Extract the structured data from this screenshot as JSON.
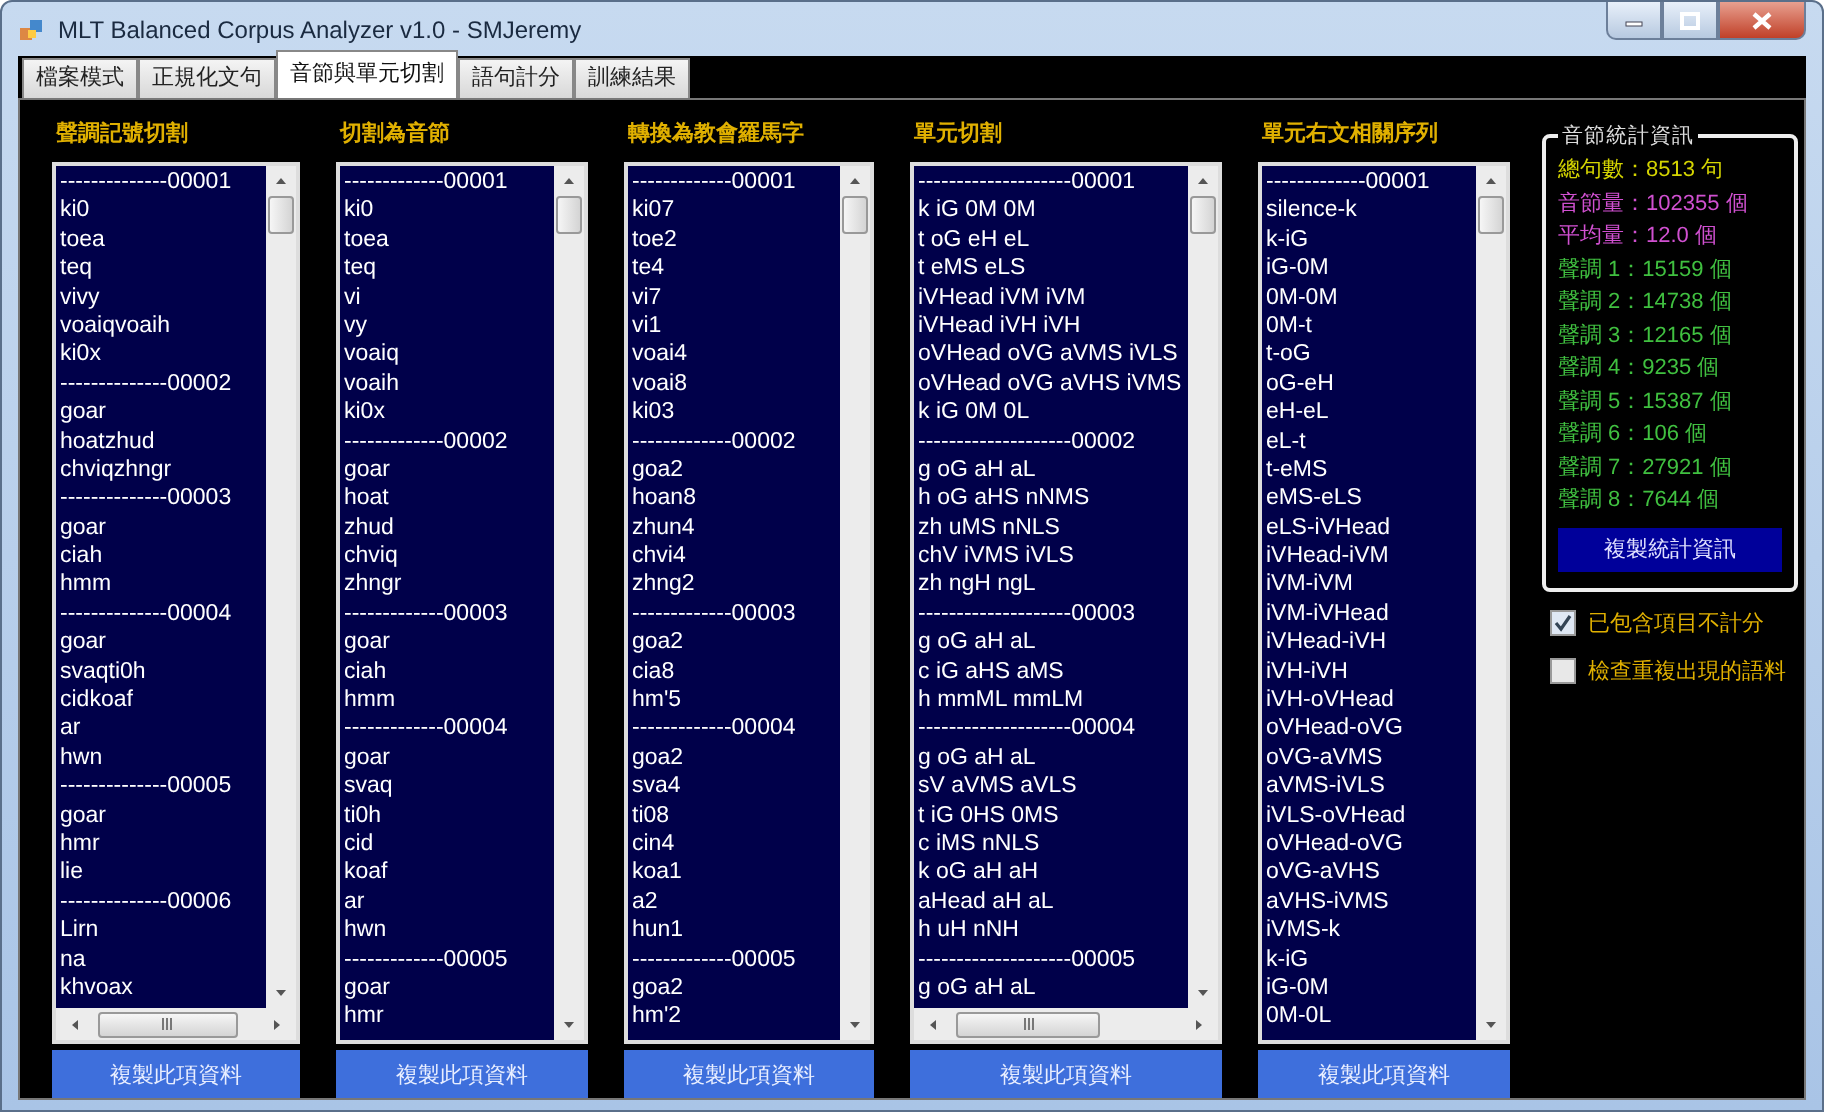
{
  "window": {
    "title": "MLT Balanced Corpus Analyzer v1.0 - SMJeremy"
  },
  "tabs": [
    {
      "label": "檔案模式",
      "selected": false
    },
    {
      "label": "正規化文句",
      "selected": false
    },
    {
      "label": "音節與單元切割",
      "selected": true
    },
    {
      "label": "語句計分",
      "selected": false
    },
    {
      "label": "訓練結果",
      "selected": false
    }
  ],
  "columns": [
    {
      "title": "聲調記號切割",
      "horizontal_scrollbar": true,
      "button": "複製此項資料",
      "lines": [
        "--------------00001",
        "ki0",
        "toea",
        "teq",
        "vivy",
        "voaiqvoaih",
        "ki0x",
        "--------------00002",
        "goar",
        "hoatzhud",
        "chviqzhngr",
        "--------------00003",
        "goar",
        "ciah",
        "hmm",
        "--------------00004",
        "goar",
        "svaqti0h",
        "cidkoaf",
        "ar",
        "hwn",
        "--------------00005",
        "goar",
        "hmr",
        "lie",
        "--------------00006",
        "Lirn",
        "na",
        "khvoax"
      ]
    },
    {
      "title": "切割為音節",
      "horizontal_scrollbar": false,
      "button": "複製此項資料",
      "lines": [
        "-------------00001",
        "ki0",
        "toea",
        "teq",
        "vi",
        "vy",
        "voaiq",
        "voaih",
        "ki0x",
        "-------------00002",
        "goar",
        "hoat",
        "zhud",
        "chviq",
        "zhngr",
        "-------------00003",
        "goar",
        "ciah",
        "hmm",
        "-------------00004",
        "goar",
        "svaq",
        "ti0h",
        "cid",
        "koaf",
        "ar",
        "hwn",
        "-------------00005",
        "goar",
        "hmr"
      ]
    },
    {
      "title": "轉換為教會羅馬字",
      "horizontal_scrollbar": false,
      "button": "複製此項資料",
      "lines": [
        "-------------00001",
        "ki07",
        "toe2",
        "te4",
        "vi7",
        "vi1",
        "voai4",
        "voai8",
        "ki03",
        "-------------00002",
        "goa2",
        "hoan8",
        "zhun4",
        "chvi4",
        "zhng2",
        "-------------00003",
        "goa2",
        "cia8",
        "hm'5",
        "-------------00004",
        "goa2",
        "sva4",
        "ti08",
        "cin4",
        "koa1",
        "a2",
        "hun1",
        "-------------00005",
        "goa2",
        "hm'2"
      ]
    },
    {
      "title": "單元切割",
      "horizontal_scrollbar": true,
      "button": "複製此項資料",
      "lines": [
        "--------------------00001",
        "k iG 0M 0M",
        "t oG eH eL",
        "t eMS eLS",
        "iVHead iVM iVM",
        "iVHead iVH iVH",
        "oVHead oVG aVMS iVLS",
        "oVHead oVG aVHS iVMS",
        "k iG 0M 0L",
        "--------------------00002",
        "g oG aH aL",
        "h oG aHS nNMS",
        "zh uMS nNLS",
        "chV iVMS iVLS",
        "zh ngH ngL",
        "--------------------00003",
        "g oG aH aL",
        "c iG aHS aMS",
        "h mmML mmLM",
        "--------------------00004",
        "g oG aH aL",
        "sV aVMS aVLS",
        "t iG 0HS 0MS",
        "c iMS nNLS",
        "k oG aH aH",
        "aHead aH aL",
        "h uH nNH",
        "--------------------00005",
        "g oG aH aL"
      ]
    },
    {
      "title": "單元右文相關序列",
      "horizontal_scrollbar": false,
      "button": "複製此項資料",
      "lines": [
        "-------------00001",
        "silence-k",
        "k-iG",
        "iG-0M",
        "0M-0M",
        "0M-t",
        "t-oG",
        "oG-eH",
        "eH-eL",
        "eL-t",
        "t-eMS",
        "eMS-eLS",
        "eLS-iVHead",
        "iVHead-iVM",
        "iVM-iVM",
        "iVM-iVHead",
        "iVHead-iVH",
        "iVH-iVH",
        "iVH-oVHead",
        "oVHead-oVG",
        "oVG-aVMS",
        "aVMS-iVLS",
        "iVLS-oVHead",
        "oVHead-oVG",
        "oVG-aVHS",
        "aVHS-iVMS",
        "iVMS-k",
        "k-iG",
        "iG-0M",
        "0M-0L"
      ]
    }
  ],
  "stats": {
    "title": "音節統計資訊",
    "button": "複製統計資訊",
    "items": [
      {
        "text": "總句數：8513 句",
        "color": "#d4d400"
      },
      {
        "text": "音節量：102355 個",
        "color": "#d050d0"
      },
      {
        "text": "平均量：12.0 個",
        "color": "#d050d0"
      },
      {
        "text": "聲調 1：15159 個",
        "color": "#40c040"
      },
      {
        "text": "聲調 2：14738 個",
        "color": "#40c040"
      },
      {
        "text": "聲調 3：12165 個",
        "color": "#40c040"
      },
      {
        "text": "聲調 4：9235 個",
        "color": "#40c040"
      },
      {
        "text": "聲調 5：15387 個",
        "color": "#40c040"
      },
      {
        "text": "聲調 6：106 個",
        "color": "#40c040"
      },
      {
        "text": "聲調 7：27921 個",
        "color": "#40c040"
      },
      {
        "text": "聲調 8：7644 個",
        "color": "#40c040"
      }
    ]
  },
  "options": [
    {
      "label": "已包含項目不計分",
      "checked": true
    },
    {
      "label": "檢查重複出現的語料",
      "checked": false
    }
  ]
}
